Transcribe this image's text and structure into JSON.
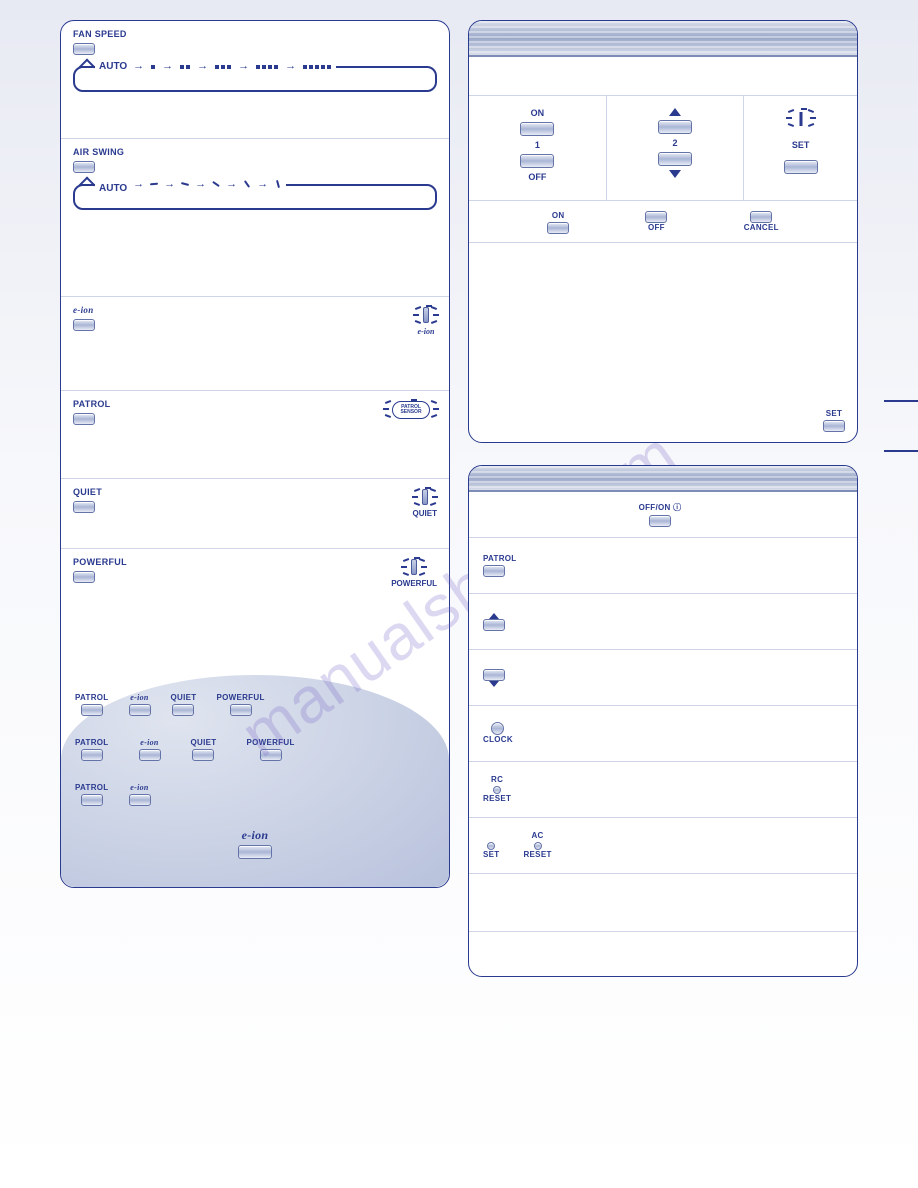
{
  "watermark": "manualshive.com",
  "left": {
    "fan_speed": {
      "label": "FAN SPEED",
      "auto": "AUTO"
    },
    "air_swing": {
      "label": "AIR SWING",
      "auto": "AUTO"
    },
    "eion": {
      "label": "e-ion",
      "indicator": "e-ion"
    },
    "patrol": {
      "label": "PATROL",
      "sensor": "PATROL SENSOR"
    },
    "quiet": {
      "label": "QUIET",
      "indicator": "QUIET"
    },
    "powerful": {
      "label": "POWERFUL",
      "indicator": "POWERFUL"
    },
    "blob_rows": {
      "r1": {
        "patrol": "PATROL",
        "eion": "e-ion",
        "quiet": "QUIET",
        "powerful": "POWERFUL"
      },
      "r2": {
        "patrol": "PATROL",
        "eion": "e-ion",
        "quiet": "QUIET",
        "powerful": "POWERFUL"
      },
      "r3": {
        "patrol": "PATROL",
        "eion": "e-ion"
      },
      "r4": {
        "eion": "e-ion"
      }
    }
  },
  "right_top": {
    "col1": {
      "on": "ON",
      "n1": "1",
      "off": "OFF"
    },
    "col2": {
      "n2": "2"
    },
    "col3": {
      "set": "SET"
    },
    "row": {
      "on": "ON",
      "off": "OFF",
      "cancel": "CANCEL"
    },
    "set_corner": "SET"
  },
  "right_bottom": {
    "offon": "OFF/ON ⓘ",
    "patrol": "PATROL",
    "clock": "CLOCK",
    "rc": "RC",
    "reset1": "RESET",
    "ac": "AC",
    "set": "SET",
    "reset2": "RESET"
  }
}
